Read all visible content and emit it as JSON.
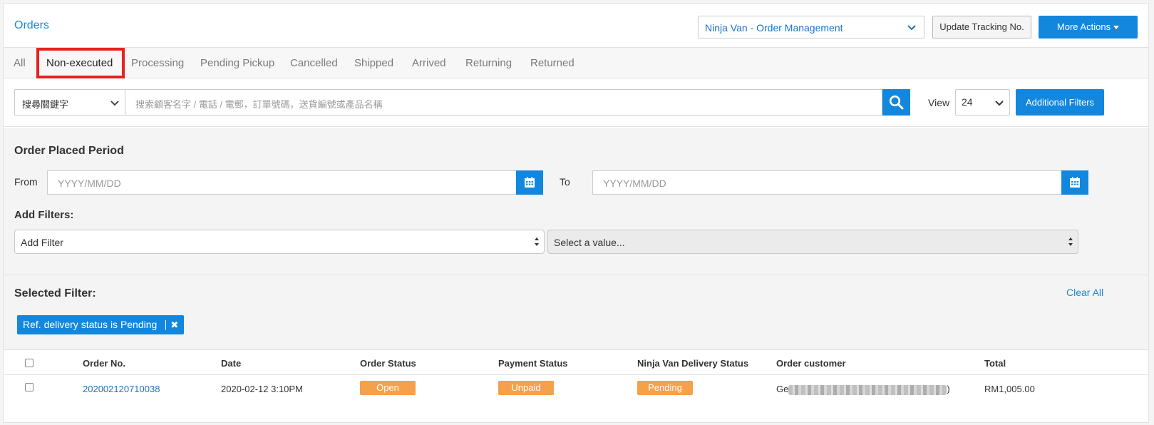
{
  "header": {
    "title": "Orders",
    "shop_selector": "Ninja Van - Order Management",
    "update_tracking_button": "Update Tracking No.",
    "more_actions_button": "More Actions"
  },
  "tabs": [
    {
      "label": "All",
      "active": false
    },
    {
      "label": "Non-executed",
      "active": true
    },
    {
      "label": "Processing",
      "active": false
    },
    {
      "label": "Pending Pickup",
      "active": false
    },
    {
      "label": "Cancelled",
      "active": false
    },
    {
      "label": "Shipped",
      "active": false
    },
    {
      "label": "Arrived",
      "active": false
    },
    {
      "label": "Returning",
      "active": false
    },
    {
      "label": "Returned",
      "active": false
    }
  ],
  "search": {
    "keyword_select": "搜尋關鍵字",
    "placeholder": "搜索顧客名字 / 電話 / 電郵，訂單號碼，送貨編號或產品名稱",
    "view_label": "View",
    "view_value": "24",
    "additional_filters_button": "Additional Filters"
  },
  "period": {
    "title": "Order Placed Period",
    "from_label": "From",
    "to_label": "To",
    "from_placeholder": "YYYY/MM/DD",
    "to_placeholder": "YYYY/MM/DD"
  },
  "filters": {
    "title": "Add Filters:",
    "add_filter_value": "Add Filter",
    "value_select": "Select a value...",
    "selected_title": "Selected Filter:",
    "clear_all": "Clear All",
    "chips": [
      "Ref. delivery status is Pending"
    ]
  },
  "table": {
    "headers": [
      "Order No.",
      "Date",
      "Order Status",
      "Payment Status",
      "Ninja Van Delivery Status",
      "Order customer",
      "Total"
    ],
    "rows": [
      {
        "order_no": "202002120710038",
        "date": "2020-02-12 3:10PM",
        "order_status": "Open",
        "payment_status": "Unpaid",
        "delivery_status": "Pending",
        "customer_start": "Ge",
        "customer_end": ")",
        "total": "RM1,005.00"
      }
    ]
  },
  "colors": {
    "accent": "#1287dd",
    "link": "#1a88d6",
    "badge": "#f5a04a",
    "highlight": "#e52320"
  }
}
